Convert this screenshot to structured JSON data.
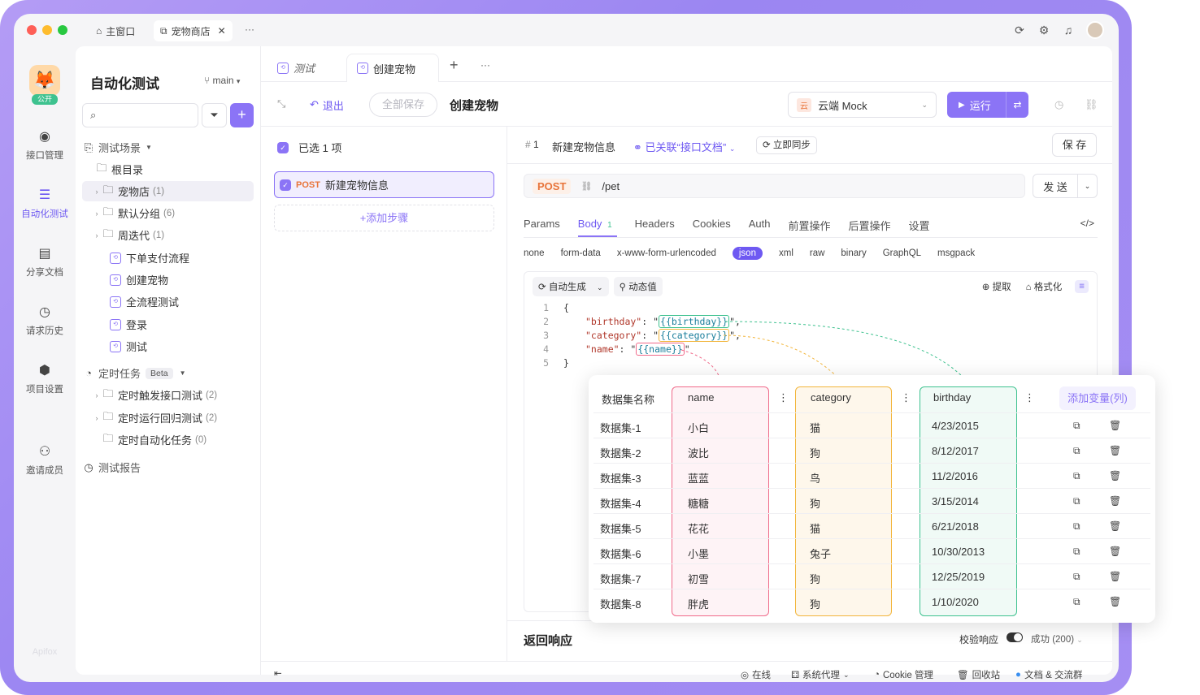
{
  "titlebar": {
    "tabs": [
      {
        "label": "主窗口"
      },
      {
        "label": "宠物商店"
      }
    ],
    "more": "···"
  },
  "rail": {
    "badge": "公开",
    "items": [
      {
        "label": "接口管理",
        "icon": "api-icon"
      },
      {
        "label": "自动化测试",
        "icon": "automation-icon"
      },
      {
        "label": "分享文档",
        "icon": "book-icon"
      },
      {
        "label": "请求历史",
        "icon": "clock-icon"
      },
      {
        "label": "项目设置",
        "icon": "settings-icon"
      },
      {
        "label": "邀请成员",
        "icon": "invite-icon"
      }
    ],
    "logo": "Apifox"
  },
  "side": {
    "title": "自动化测试",
    "branch": "main",
    "search_placeholder": "",
    "tree": [
      {
        "label": "测试场景",
        "count": "",
        "kind": "section"
      },
      {
        "label": "根目录",
        "count": "",
        "kind": "folder-root"
      },
      {
        "label": "宠物店",
        "count": "(1)",
        "kind": "folder"
      },
      {
        "label": "默认分组",
        "count": "(6)",
        "kind": "folder"
      },
      {
        "label": "周迭代",
        "count": "(1)",
        "kind": "folder"
      },
      {
        "label": "下单支付流程",
        "count": "",
        "kind": "case"
      },
      {
        "label": "创建宠物",
        "count": "",
        "kind": "case"
      },
      {
        "label": "全流程测试",
        "count": "",
        "kind": "case"
      },
      {
        "label": "登录",
        "count": "",
        "kind": "case"
      },
      {
        "label": "测试",
        "count": "",
        "kind": "case"
      },
      {
        "label": "定时任务",
        "count": "",
        "kind": "section",
        "beta": "Beta"
      },
      {
        "label": "定时触发接口测试",
        "count": "(2)",
        "kind": "folder"
      },
      {
        "label": "定时运行回归测试",
        "count": "(2)",
        "kind": "folder"
      },
      {
        "label": "定时自动化任务",
        "count": "(0)",
        "kind": "folder-root"
      },
      {
        "label": "测试报告",
        "count": "",
        "kind": "section"
      }
    ]
  },
  "main": {
    "tabs": [
      {
        "label": "测试"
      },
      {
        "label": "创建宠物"
      }
    ],
    "toolbar": {
      "exit": "退出",
      "save_all": "全部保存",
      "title": "创建宠物",
      "env_badge": "云",
      "env": "云端 Mock",
      "run": "运行"
    },
    "steps": {
      "selected": "已选 1 项",
      "step_method": "POST",
      "step_name": "新建宠物信息",
      "add_step": "添加步骤"
    },
    "detail": {
      "index": "1",
      "name": "新建宠物信息",
      "linked": "已关联“接口文档”",
      "sync": "立即同步",
      "save": "保 存",
      "method": "POST",
      "path": "/pet",
      "send": "发 送",
      "req_tabs": [
        "Params",
        "Body",
        "Headers",
        "Cookies",
        "Auth",
        "前置操作",
        "后置操作",
        "设置"
      ],
      "body_count": "1",
      "body_types": [
        "none",
        "form-data",
        "x-www-form-urlencoded",
        "json",
        "xml",
        "raw",
        "binary",
        "GraphQL",
        "msgpack"
      ],
      "auto_gen": "自动生成",
      "dynamic": "动态值",
      "extract": "提取",
      "format": "格式化",
      "code": {
        "l1": "{",
        "birthday_key": "\"birthday\"",
        "birthday_var": "{{birthday}}",
        "category_key": "\"category\"",
        "category_var": "{{category}}",
        "name_key": "\"name\"",
        "name_var": "{{name}}",
        "l5": "}"
      },
      "response": "返回响应",
      "validate": "校验响应",
      "status": "成功 (200)"
    },
    "statusbar": {
      "online": "在线",
      "proxy": "系统代理",
      "cookie": "Cookie 管理",
      "trash": "回收站",
      "docs": "文档 & 交流群"
    }
  },
  "dataset": {
    "headers": {
      "setname": "数据集名称",
      "name": "name",
      "category": "category",
      "birthday": "birthday",
      "add": "添加变量(列)"
    },
    "rows": [
      {
        "set": "数据集-1",
        "name": "小白",
        "category": "猫",
        "birthday": "4/23/2015"
      },
      {
        "set": "数据集-2",
        "name": "波比",
        "category": "狗",
        "birthday": "8/12/2017"
      },
      {
        "set": "数据集-3",
        "name": "蓝蓝",
        "category": "鸟",
        "birthday": "11/2/2016"
      },
      {
        "set": "数据集-4",
        "name": "糖糖",
        "category": "狗",
        "birthday": "3/15/2014"
      },
      {
        "set": "数据集-5",
        "name": "花花",
        "category": "猫",
        "birthday": "6/21/2018"
      },
      {
        "set": "数据集-6",
        "name": "小墨",
        "category": "兔子",
        "birthday": "10/30/2013"
      },
      {
        "set": "数据集-7",
        "name": "初雪",
        "category": "狗",
        "birthday": "12/25/2019"
      },
      {
        "set": "数据集-8",
        "name": "胖虎",
        "category": "狗",
        "birthday": "1/10/2020"
      }
    ],
    "colors": {
      "name": "#f06a8a",
      "category": "#f2b53a",
      "birthday": "#3ec28f"
    }
  }
}
